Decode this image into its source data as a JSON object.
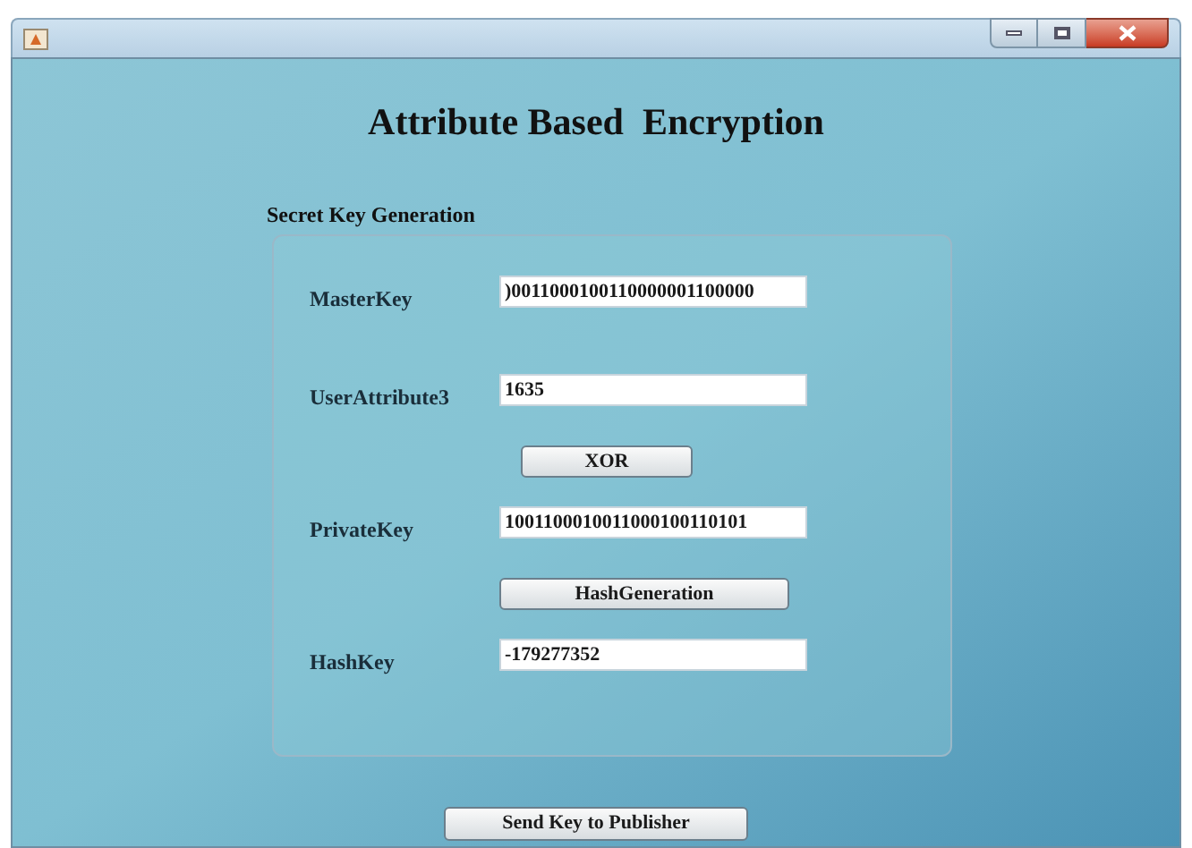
{
  "window": {
    "title_buttons": [
      {
        "kind": "minimize"
      },
      {
        "kind": "maximize"
      },
      {
        "kind": "close"
      }
    ]
  },
  "heading": "Attribute Based  Encryption",
  "section": {
    "title": "Secret Key Generation",
    "rows": [
      {
        "kind": "field",
        "label": "MasterKey",
        "value": ")0011000100110000001100000"
      },
      {
        "kind": "field",
        "label": "UserAttribute3",
        "value": "1635"
      },
      {
        "kind": "button",
        "label": "XOR"
      },
      {
        "kind": "field",
        "label": "PrivateKey",
        "value": "1001100010011000100110101"
      },
      {
        "kind": "button",
        "label": "HashGeneration"
      },
      {
        "kind": "field",
        "label": "HashKey",
        "value": "-179277352"
      }
    ]
  },
  "footer_button": "Send Key to Publisher"
}
